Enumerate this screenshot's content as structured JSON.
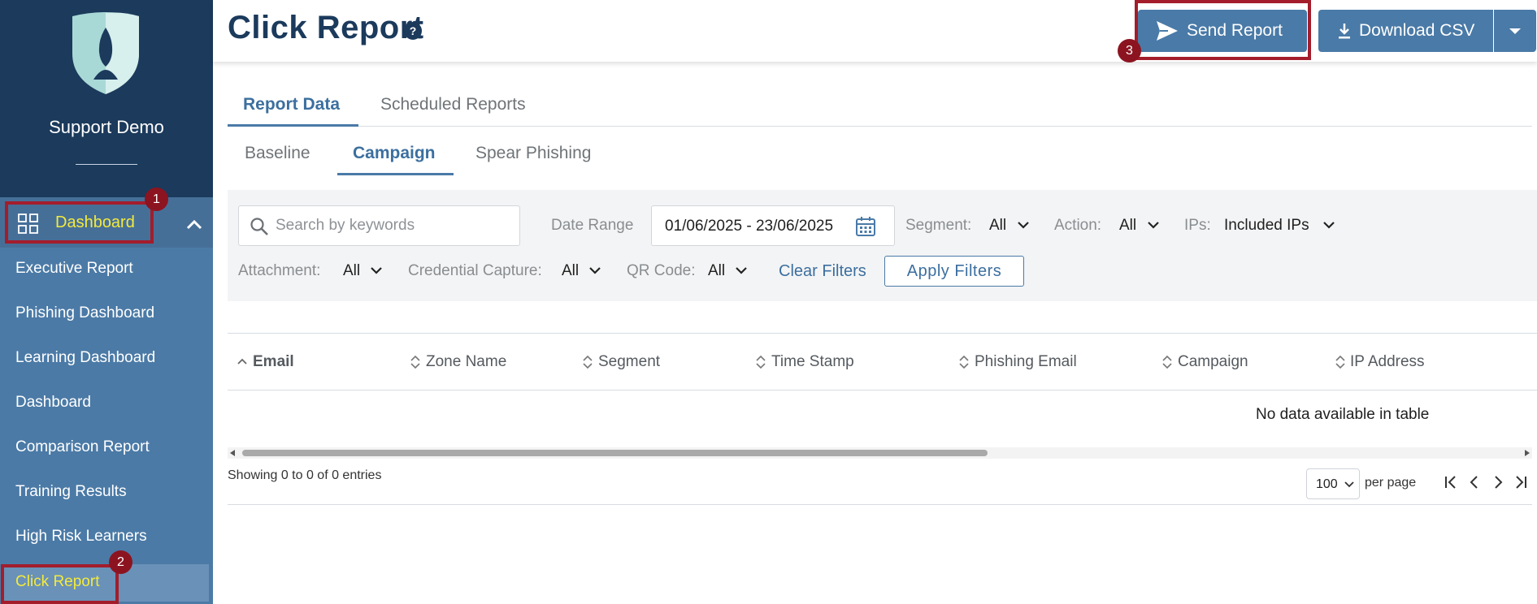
{
  "sidebar": {
    "org_name": "Support Demo",
    "dashboard_label": "Dashboard",
    "items": [
      {
        "label": "Executive Report"
      },
      {
        "label": "Phishing Dashboard"
      },
      {
        "label": "Learning Dashboard"
      },
      {
        "label": "Dashboard"
      },
      {
        "label": "Comparison Report"
      },
      {
        "label": "Training Results"
      },
      {
        "label": "High Risk Learners"
      }
    ],
    "active_item": "Click Report"
  },
  "header": {
    "title": "Click Report",
    "help_glyph": "?",
    "send_report_label": "Send Report",
    "download_csv_label": "Download CSV"
  },
  "tabs": {
    "primary": [
      "Report Data",
      "Scheduled Reports"
    ],
    "primary_active": "Report Data",
    "secondary": [
      "Baseline",
      "Campaign",
      "Spear Phishing"
    ],
    "secondary_active": "Campaign"
  },
  "filters": {
    "search_placeholder": "Search by keywords",
    "date_range_label": "Date Range",
    "date_range_value": "01/06/2025 - 23/06/2025",
    "segment_label": "Segment:",
    "segment_value": "All",
    "action_label": "Action:",
    "action_value": "All",
    "ips_label": "IPs:",
    "ips_value": "Included IPs",
    "attachment_label": "Attachment:",
    "attachment_value": "All",
    "credential_label": "Credential Capture:",
    "credential_value": "All",
    "qr_label": "QR Code:",
    "qr_value": "All",
    "clear_label": "Clear Filters",
    "apply_label": "Apply Filters"
  },
  "table": {
    "columns": [
      "Email",
      "Zone Name",
      "Segment",
      "Time Stamp",
      "Phishing Email",
      "Campaign",
      "IP Address"
    ],
    "empty_message": "No data available in table",
    "info": "Showing 0 to 0 of 0 entries",
    "per_page_value": "100",
    "per_page_label": "per page"
  },
  "annotations": [
    "1",
    "2",
    "3"
  ],
  "colors": {
    "sidebar_top": "#1b3a5c",
    "sidebar": "#4b7aa6",
    "accent": "#4a7aa7",
    "active_text": "#f3ea3c",
    "annotation": "#a31d2b"
  }
}
